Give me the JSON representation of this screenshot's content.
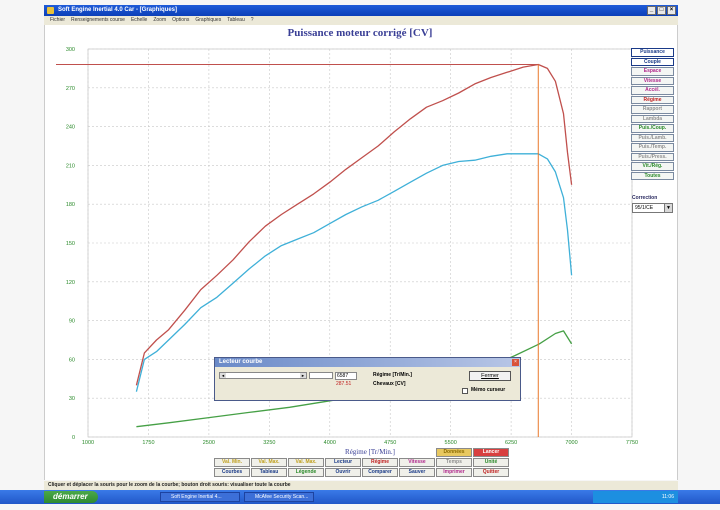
{
  "window": {
    "title": "Soft Engine Inertial 4.0 Car - [Graphiques]",
    "controls": [
      "_",
      "□",
      "×"
    ]
  },
  "menu": [
    "Fichier",
    "Renseignements course",
    "Echelle",
    "Zoom",
    "Options",
    "Graphiques",
    "Tableau",
    "?"
  ],
  "chart_data": {
    "type": "line",
    "title": "Puissance moteur corrigé [CV]",
    "xlabel": "Régime [Tr/Min.]",
    "ylabel": "",
    "xlim": [
      1000,
      7750
    ],
    "ylim": [
      0,
      300
    ],
    "x_ticks": [
      "1000",
      "1750",
      "2500",
      "3250",
      "4000",
      "4750",
      "5500",
      "6250",
      "7000",
      "7750"
    ],
    "y_ticks": [
      "0",
      "30",
      "60",
      "90",
      "120",
      "150",
      "180",
      "210",
      "240",
      "270",
      "300"
    ],
    "grid": true,
    "cursor_x": 6587,
    "series": [
      {
        "color": "#c0504d",
        "x": [
          1600,
          1700,
          1850,
          2000,
          2200,
          2400,
          2600,
          2800,
          3000,
          3200,
          3400,
          3600,
          3800,
          4000,
          4200,
          4400,
          4600,
          4800,
          5000,
          5200,
          5400,
          5600,
          5800,
          6000,
          6200,
          6400,
          6587,
          6700,
          6800,
          6900,
          6950,
          7000
        ],
        "y": [
          40,
          65,
          75,
          83,
          98,
          114,
          125,
          137,
          151,
          163,
          172,
          180,
          188,
          197,
          207,
          216,
          225,
          236,
          246,
          255,
          260,
          266,
          273,
          278,
          282,
          286,
          288,
          285,
          275,
          250,
          220,
          195
        ]
      },
      {
        "color": "#3fb0d8",
        "x": [
          1600,
          1700,
          1850,
          2000,
          2200,
          2400,
          2600,
          2800,
          3000,
          3200,
          3400,
          3600,
          3800,
          4000,
          4200,
          4400,
          4600,
          4800,
          5000,
          5200,
          5400,
          5600,
          5800,
          6000,
          6200,
          6400,
          6587,
          6700,
          6800,
          6900,
          6950,
          7000
        ],
        "y": [
          35,
          60,
          66,
          75,
          87,
          100,
          108,
          119,
          130,
          140,
          148,
          153,
          158,
          165,
          172,
          178,
          183,
          190,
          197,
          204,
          210,
          213,
          214,
          217,
          219,
          219,
          219,
          215,
          205,
          185,
          160,
          125
        ]
      },
      {
        "color": "#46a046",
        "x": [
          1600,
          2000,
          2500,
          3000,
          3500,
          4000,
          4500,
          5000,
          5500,
          6000,
          6300,
          6600,
          6800,
          6900,
          7000
        ],
        "y": [
          8,
          11,
          15,
          19,
          23,
          28,
          33,
          39,
          46,
          55,
          63,
          72,
          80,
          82,
          72
        ]
      }
    ]
  },
  "side_buttons": [
    {
      "label": "Puissance",
      "color": "#1a3a88"
    },
    {
      "label": "Couple",
      "color": "#1a3a88"
    },
    {
      "label": "Espace",
      "color": "#b0288c"
    },
    {
      "label": "Vitesse",
      "color": "#b0288c"
    },
    {
      "label": "Accél.",
      "color": "#b0288c"
    },
    {
      "label": "Régime",
      "color": "#c02020"
    },
    {
      "label": "Rapport",
      "color": "#909090"
    },
    {
      "label": "Lambda",
      "color": "#909090"
    },
    {
      "label": "Puis./Coup.",
      "color": "#2a8a2a"
    },
    {
      "label": "Puis./Lamb.",
      "color": "#909090"
    },
    {
      "label": "Puis./Temp.",
      "color": "#909090"
    },
    {
      "label": "Puis./Press.",
      "color": "#909090"
    },
    {
      "label": "Vit./Rég.",
      "color": "#2a8a2a"
    },
    {
      "label": "Toutes",
      "color": "#2a8a2a"
    }
  ],
  "correction": {
    "label": "Correction",
    "value": "95/1/CE"
  },
  "grid_buttons": {
    "row1": [
      {
        "label": "",
        "color": ""
      },
      {
        "label": "",
        "color": ""
      },
      {
        "label": "",
        "color": ""
      },
      {
        "label": "",
        "color": ""
      },
      {
        "label": "",
        "color": ""
      },
      {
        "label": "Données",
        "color": "#8a6a00",
        "bg": "#e8c860"
      },
      {
        "label": "Lancer",
        "color": "#ffffff",
        "bg": "#d84040"
      }
    ],
    "row2": [
      {
        "label": "Val. Min.",
        "color": "#c0a020"
      },
      {
        "label": "Val. Max.",
        "color": "#c0a020"
      },
      {
        "label": "Val. Max.",
        "color": "#c0a020"
      },
      {
        "label": "Lecteur",
        "color": "#1a3a88"
      },
      {
        "label": "Régime",
        "color": "#c02020"
      },
      {
        "label": "Vitesse",
        "color": "#b0288c"
      },
      {
        "label": "Temps",
        "color": "#909090"
      },
      {
        "label": "Unité",
        "color": "#2a8a2a"
      }
    ],
    "row3": [
      {
        "label": "Courbes",
        "color": "#1a3a88"
      },
      {
        "label": "Tableau",
        "color": "#1a3a88"
      },
      {
        "label": "Légende",
        "color": "#2a8a2a"
      },
      {
        "label": "Ouvrir",
        "color": "#1a3a88"
      },
      {
        "label": "Comparer",
        "color": "#1a3a88"
      },
      {
        "label": "Sauver",
        "color": "#1a3a88"
      },
      {
        "label": "Imprimer",
        "color": "#b0288c"
      },
      {
        "label": "Quitter",
        "color": "#c02020"
      }
    ]
  },
  "status": "Cliquer et déplacer la souris pour le zoom de la courbe; bouton droit souris: visualiser toute la courbe",
  "taskbar": {
    "start": "démarrer",
    "tasks": [
      "Soft Engine Inertial 4...",
      "McAfee Security Scan..."
    ],
    "clock": "11:06"
  },
  "dialog": {
    "title": "Lecteur courbe",
    "regime_value": "6587",
    "cv_value": "287.51",
    "regime_label": "Régime [Tr/Min.]",
    "cv_label": "Chevaux [CV]",
    "close_button": "Fermer",
    "checkbox_label": "Mémo curseur",
    "close_glyph": "×"
  }
}
